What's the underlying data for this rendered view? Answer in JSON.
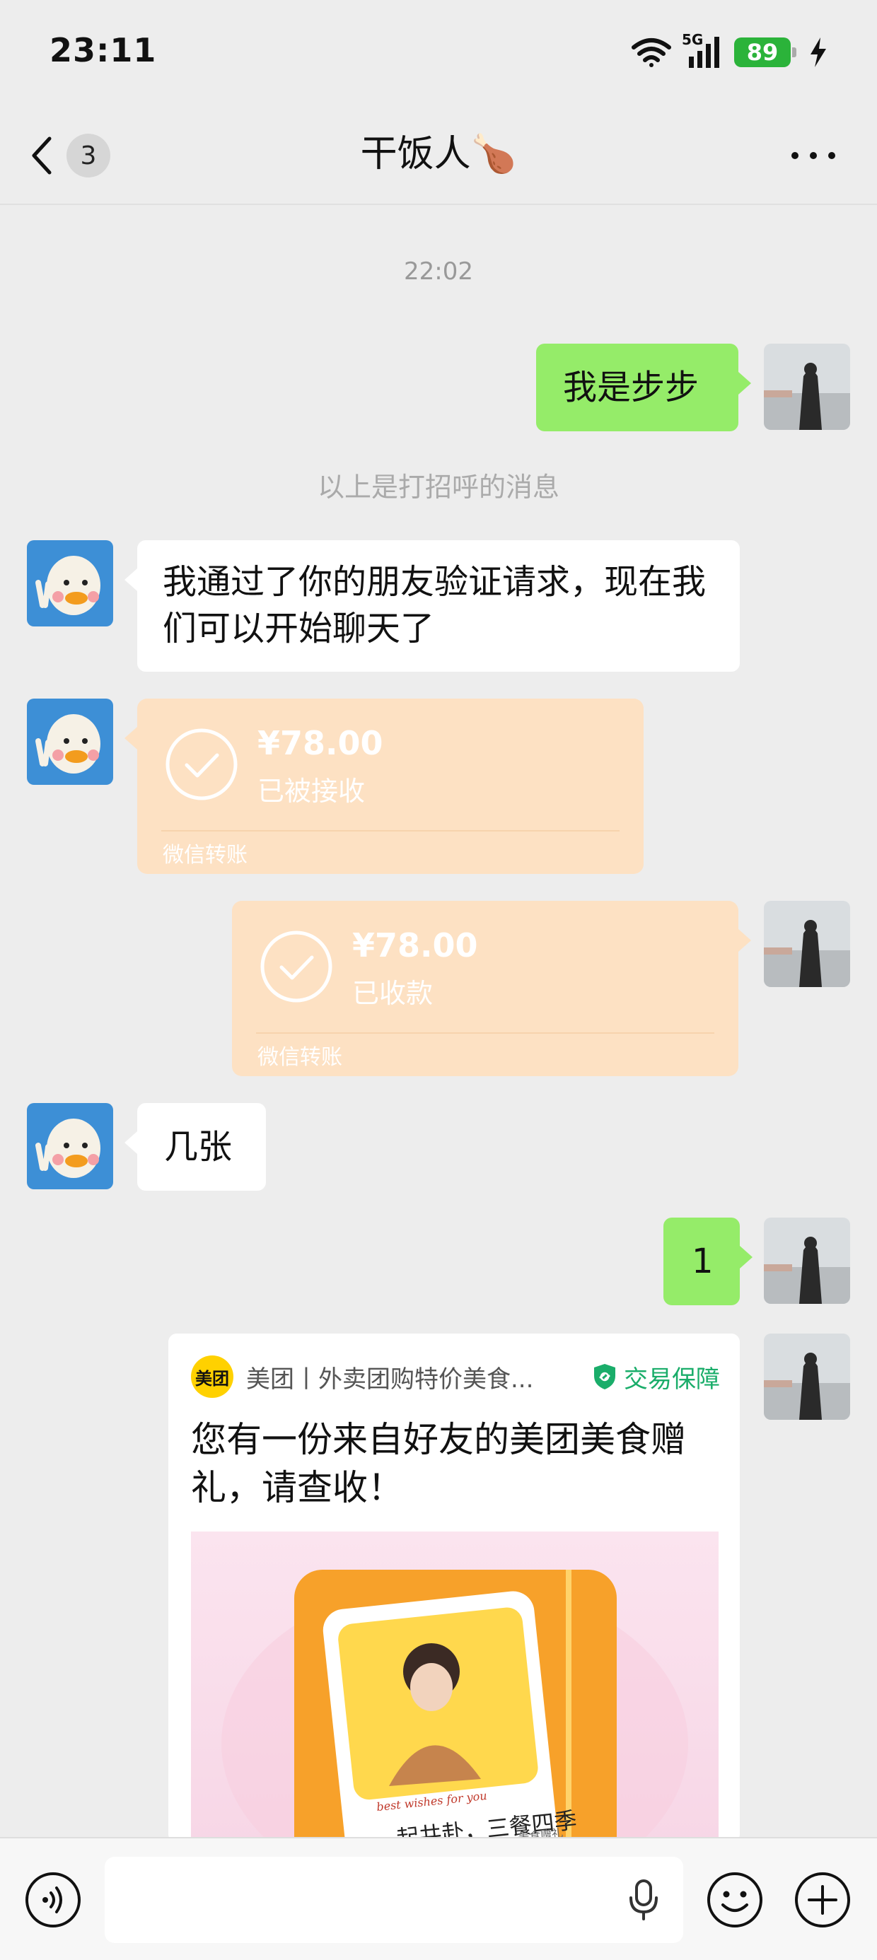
{
  "status_bar": {
    "time": "23:11",
    "battery": "89",
    "network": "5G"
  },
  "header": {
    "back_badge": "3",
    "title": "干饭人🍗",
    "more_icon": "more-dots-icon"
  },
  "chat": {
    "time_separator": "22:02",
    "system_notice": "以上是打招呼的消息",
    "messages": [
      {
        "side": "out",
        "type": "text",
        "text": "我是步步"
      },
      {
        "side": "in",
        "type": "text",
        "text": "我通过了你的朋友验证请求，现在我们可以开始聊天了"
      },
      {
        "side": "in",
        "type": "transfer",
        "amount": "¥78.00",
        "status": "已被接收",
        "label": "微信转账"
      },
      {
        "side": "out",
        "type": "transfer",
        "amount": "¥78.00",
        "status": "已收款",
        "label": "微信转账"
      },
      {
        "side": "in",
        "type": "text",
        "text": "几张"
      },
      {
        "side": "out",
        "type": "text",
        "text": "1"
      },
      {
        "side": "out",
        "type": "mini_program",
        "logo": "美团",
        "app_name": "美团丨外卖团购特价美食...",
        "badge": "交易保障",
        "title": "您有一份来自好友的美团美食赠礼，请查收！",
        "image_caption": "一起共赴，三餐四季",
        "image_tag": "美食赠礼",
        "image_script": "best wishes for you"
      }
    ]
  },
  "input_bar": {
    "voice_icon": "voice-mode-icon",
    "placeholder": "",
    "mic_icon": "microphone-icon",
    "emoji_icon": "emoji-icon",
    "plus_icon": "plus-icon"
  },
  "colors": {
    "background": "#ededed",
    "outgoing_bubble": "#95ec69",
    "incoming_bubble": "#ffffff",
    "transfer_bubble": "#fde1c3",
    "guarantee_green": "#1aad6a",
    "battery_green": "#2bb33a"
  }
}
